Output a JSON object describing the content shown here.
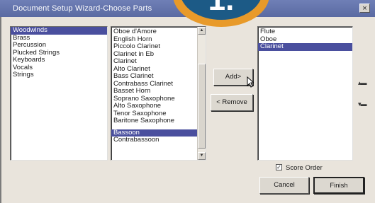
{
  "window": {
    "title": "Document Setup Wizard-Choose Parts",
    "close_label": "×"
  },
  "badge": {
    "number": "1."
  },
  "families": {
    "items": [
      "Woodwinds",
      "Brass",
      "Percussion",
      "Plucked Strings",
      "Keyboards",
      "Vocals",
      "Strings"
    ],
    "selected": "Woodwinds"
  },
  "instruments": {
    "items": [
      "Oboe d'Amore",
      "English Horn",
      "Piccolo Clarinet",
      "Clarinet in Eb",
      "Clarinet",
      "Alto Clarinet",
      "Bass Clarinet",
      "Contrabass Clarinet",
      "Basset Horn",
      "Soprano Saxophone",
      "Alto Saxophone",
      "Tenor Saxophone",
      "Baritone Saxophone",
      "",
      "Bassoon",
      "Contrabassoon"
    ],
    "selected": "Bassoon"
  },
  "chosen": {
    "items": [
      "Flute",
      "Oboe",
      "Clarinet"
    ],
    "selected": "Clarinet"
  },
  "buttons": {
    "add": "Add> ",
    "remove": "< Remove",
    "cancel": "Cancel",
    "finish": "Finish"
  },
  "score_order": {
    "label": "Score Order",
    "checked": true
  },
  "side_icons": {
    "move_up": "icon-up",
    "move_down": "icon-down"
  }
}
